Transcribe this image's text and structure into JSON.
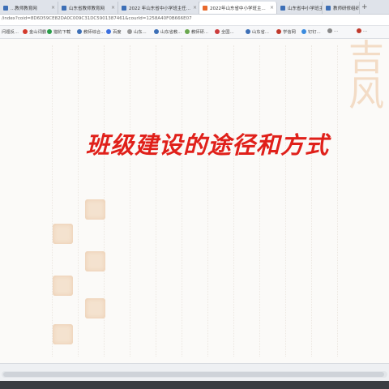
{
  "tabs": [
    {
      "label": "...教师教育网",
      "color": "#3d6fb6",
      "active": false
    },
    {
      "label": "山东省教师教育网",
      "color": "#3d6fb6",
      "active": false
    },
    {
      "label": "2022 年山东省中小学班主任...",
      "color": "#3d6fb6",
      "active": false
    },
    {
      "label": "2022年山东省中小学班主...",
      "color": "#e8692c",
      "active": true
    },
    {
      "label": "山东省中小学班主...",
      "color": "#3d6fb6",
      "active": false
    },
    {
      "label": "教师研修组织...",
      "color": "#3d6fb6",
      "active": false
    }
  ],
  "new_tab_label": "+",
  "address": "/index?coid=8D6D59CE82DA0C009C31DC5901387461&courId=1258A40F0B666E07",
  "bookmarks": [
    {
      "label": "问题反...",
      "color": "#4a7fd0"
    },
    {
      "label": "金山词霸",
      "color": "#d33a2c"
    },
    {
      "label": "猎豹下载",
      "color": "#2a9d4a"
    },
    {
      "label": "教师综合...",
      "color": "#3d6fb6"
    },
    {
      "label": "百度",
      "color": "#3b6fe0"
    },
    {
      "label": "山东...",
      "color": "#999999"
    },
    {
      "label": "山东省教...",
      "color": "#3d6fb6"
    },
    {
      "label": "教师研...",
      "color": "#6aa84f"
    },
    {
      "label": "全国...",
      "color": "#cc3d3d"
    },
    {
      "label": "山东省...",
      "color": "#3d6fb6"
    },
    {
      "label": "学信网",
      "color": "#c0392b"
    },
    {
      "label": "钉钉...",
      "color": "#3b8bde"
    },
    {
      "label": "...",
      "color": "#888888"
    },
    {
      "label": "...",
      "color": "#c0392b"
    }
  ],
  "slide": {
    "title": "班级建设的途径和方式",
    "title_color": "#e0201a",
    "decorative_text": "吉\n风",
    "stamp_color": "#f4e2cf"
  }
}
